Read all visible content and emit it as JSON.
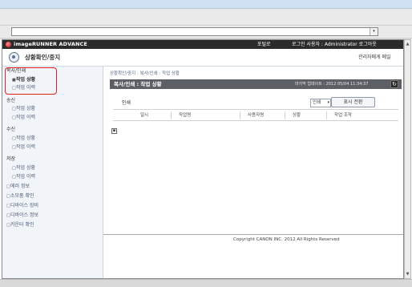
{
  "browser": {
    "address_value": "",
    "dropdown_glyph": "▾"
  },
  "header": {
    "brand": "imageRUNNER ADVANCE",
    "portal_link": "포털로",
    "user_info": "로그인 사용자 : Administrator 로그아웃"
  },
  "subheader": {
    "title": "상황확인/중지",
    "admin_link": "관리자메게 메일"
  },
  "sidebar": {
    "items": [
      {
        "label": "복사/인쇄",
        "kind": "cat"
      },
      {
        "label": "작업 상황",
        "kind": "sub",
        "active": true
      },
      {
        "label": "작업 이력",
        "kind": "sub"
      },
      {
        "label": "송신",
        "kind": "cat"
      },
      {
        "label": "작업 상황",
        "kind": "sub"
      },
      {
        "label": "작업 이력",
        "kind": "sub"
      },
      {
        "label": "수신",
        "kind": "cat"
      },
      {
        "label": "작업 상황",
        "kind": "sub"
      },
      {
        "label": "작업 이력",
        "kind": "sub"
      },
      {
        "label": "저장",
        "kind": "cat"
      },
      {
        "label": "작업 상황",
        "kind": "sub"
      },
      {
        "label": "작업 이력",
        "kind": "sub"
      },
      {
        "label": "에러 정보",
        "kind": "top"
      },
      {
        "label": "소모품 확인",
        "kind": "top"
      },
      {
        "label": "디바이스 장비",
        "kind": "top"
      },
      {
        "label": "디바이스 정보",
        "kind": "top"
      },
      {
        "label": "카운터 확인",
        "kind": "top"
      }
    ]
  },
  "main": {
    "breadcrumb": "상황확인/중지 : 복사/인쇄 : 작업 상황",
    "section_title": "복사/인쇄 : 작업 상황",
    "last_update": "마지막 업데이트 : 2012 05/04 11:34:37",
    "refresh_icon": "↻",
    "print_label": "인쇄",
    "select_value": "인쇄",
    "toggle_button": "표시 전환",
    "columns": [
      "일시",
      "작업명",
      "사용자명",
      "상황",
      "작업 조작"
    ],
    "expand_glyph": "▪"
  },
  "footer": {
    "copyright": "Copyright CANON INC. 2012 All Rights Reserved"
  },
  "colors": {
    "header_bg": "#2b2b2b",
    "section_bar": "#5c5f66",
    "highlight_box": "#e0201f",
    "sidebar_bg": "#f1f4f8"
  }
}
